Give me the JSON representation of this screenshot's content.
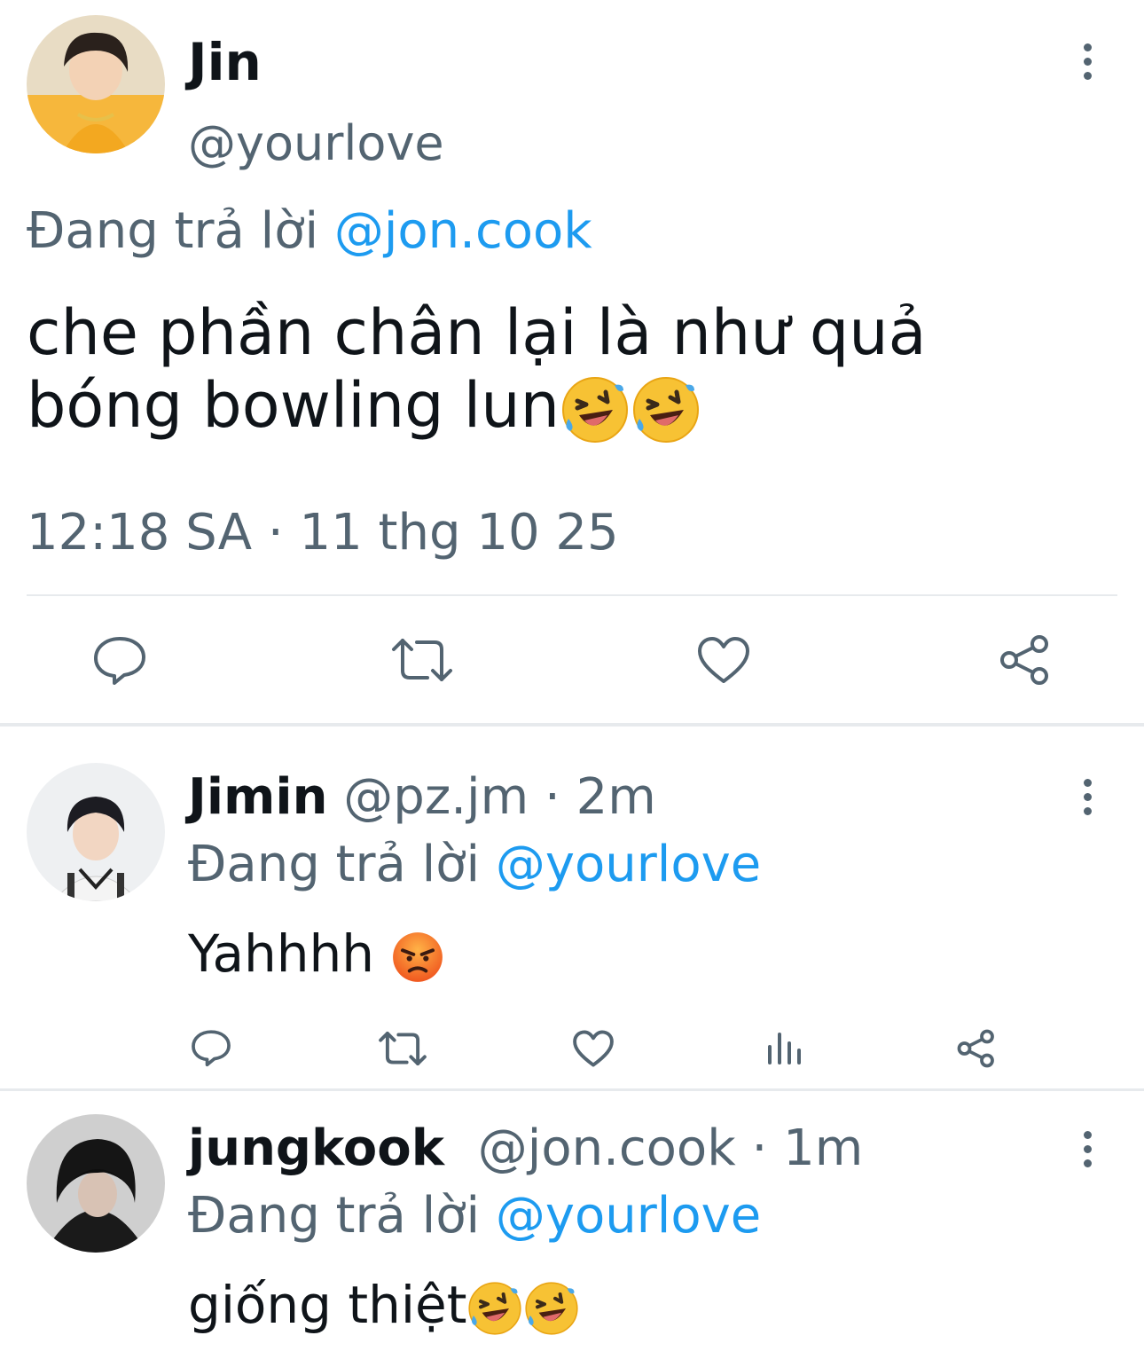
{
  "main_tweet": {
    "display_name": "Jin",
    "handle": "@yourlove",
    "reply_prefix": "Đang trả lời",
    "reply_to": "@jon.cook",
    "text_line1": "che phần chân lại là như quả",
    "text_line2": "bóng bowling lun",
    "emojis": [
      "rolling-on-floor-laughing",
      "rolling-on-floor-laughing"
    ],
    "timestamp": "12:18 SA · 11 thg 10 25",
    "actions": [
      "reply-icon",
      "retweet-icon",
      "like-icon",
      "share-icon"
    ]
  },
  "replies": [
    {
      "display_name": "Jimin",
      "handle": "@pz.jm",
      "separator": "·",
      "time": "2m",
      "reply_prefix": "Đang trả lời",
      "reply_to": "@yourlove",
      "text": "Yahhhh",
      "emojis": [
        "angry-face"
      ],
      "actions": [
        "reply-icon",
        "retweet-icon",
        "like-icon",
        "views-icon",
        "share-icon"
      ]
    },
    {
      "display_name": "jungkook",
      "handle": "@jon.cook",
      "separator": "·",
      "time": "1m",
      "reply_prefix": "Đang trả lời",
      "reply_to": "@yourlove",
      "text": "giống thiệt",
      "emojis": [
        "rolling-on-floor-laughing",
        "rolling-on-floor-laughing"
      ]
    }
  ],
  "colors": {
    "text": "#0f1419",
    "muted": "#536471",
    "link": "#1d9bf0",
    "divider": "#e7eaed"
  }
}
